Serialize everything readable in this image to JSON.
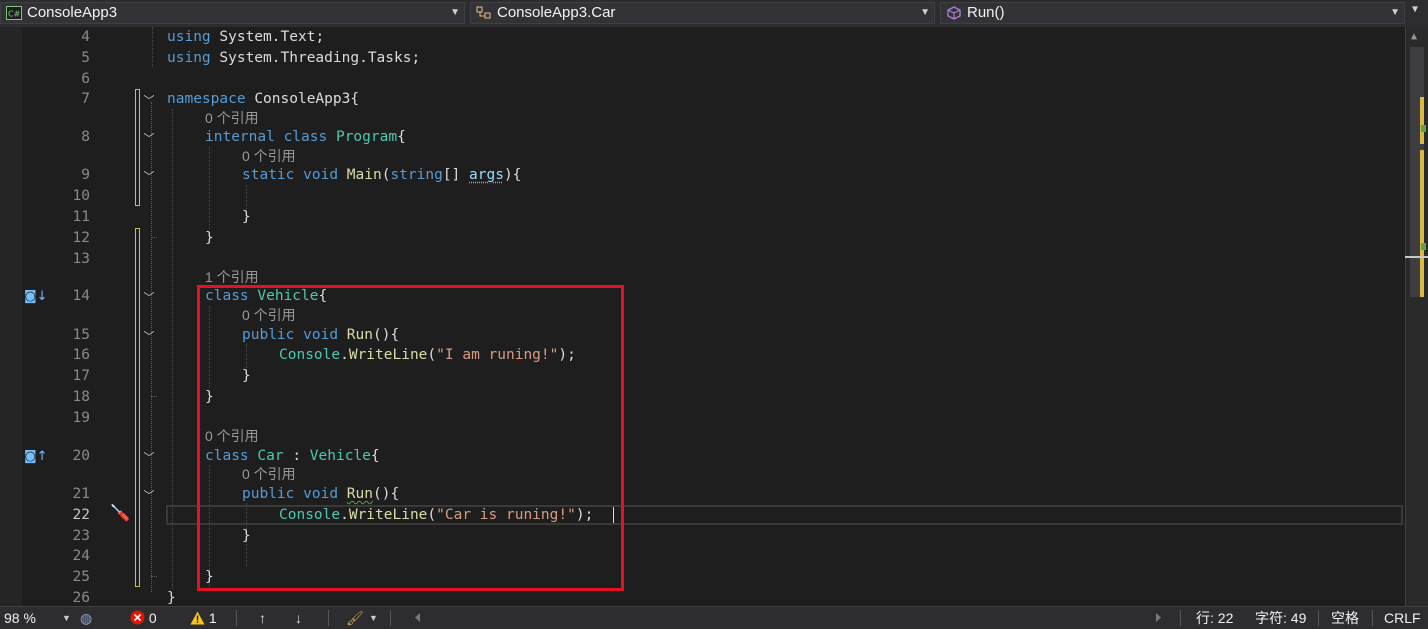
{
  "navbar": {
    "project": "ConsoleApp3",
    "project_icon": "csharp-project-icon",
    "class": "ConsoleApp3.Car",
    "class_icon": "class-icon",
    "member": "Run()",
    "member_icon": "method-icon"
  },
  "editor": {
    "current_line": 22,
    "line_numbers": {
      "l4": "4",
      "l5": "5",
      "l6": "6",
      "l7": "7",
      "l8": "8",
      "l9": "9",
      "l10": "10",
      "l11": "11",
      "l12": "12",
      "l13": "13",
      "l14": "14",
      "l15": "15",
      "l16": "16",
      "l17": "17",
      "l18": "18",
      "l19": "19",
      "l20": "20",
      "l21": "21",
      "l22": "22",
      "l23": "23",
      "l24": "24",
      "l25": "25",
      "l26": "26"
    },
    "code": {
      "using": "using",
      "system": "System",
      "dot": ".",
      "text": "Text",
      "threading": "Threading",
      "tasks": "Tasks",
      "semi": ";",
      "namespace": "namespace",
      "ns_name": "ConsoleApp3{",
      "internal": "internal",
      "class": "class",
      "program": "Program",
      "lbrace": "{",
      "rbrace": "}",
      "static": "static",
      "void": "void",
      "main": "Main",
      "lparen": "(",
      "string": "string",
      "brackets": "[] ",
      "args": "args",
      "paren_brace": "){",
      "vehicle": "Vehicle",
      "public": "public",
      "run": "Run",
      "empty_parens_brace": "(){",
      "console": "Console",
      "writeline": "WriteLine",
      "str1": "\"I am runing!\"",
      "str2": "\"Car is runing!\"",
      "close_stmt": ");",
      "car": "Car",
      "colon": " : "
    },
    "code_lens": {
      "ref0": "0 个引用",
      "ref1": "1 个引用"
    }
  },
  "statusbar": {
    "zoom": "98 %",
    "errors": "0",
    "warnings": "1",
    "line": "行: 22",
    "char": "字符: 49",
    "indent": "空格",
    "eol": "CRLF"
  },
  "colors": {
    "keyword": "#569cd6",
    "type": "#4ec9b0",
    "method": "#dcdcaa",
    "string": "#d69d85",
    "highlight_box": "#e81123"
  }
}
